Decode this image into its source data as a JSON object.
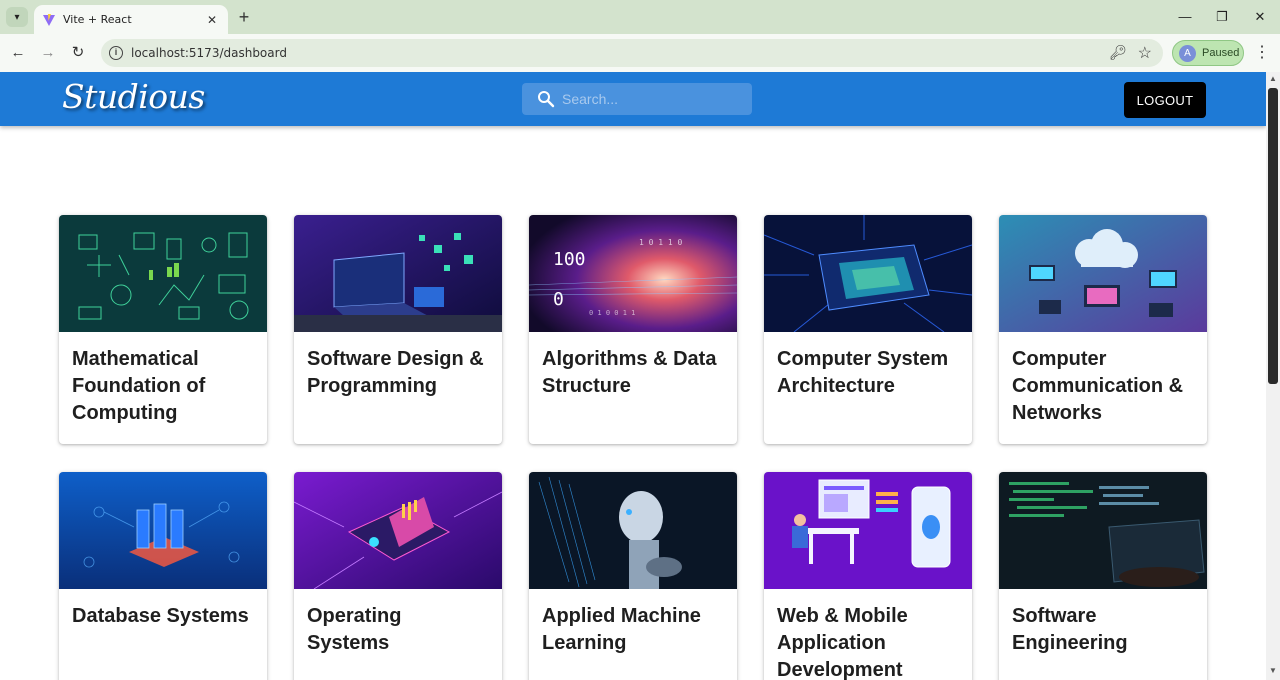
{
  "browser": {
    "tab_title": "Vite + React",
    "url": "localhost:5173/dashboard",
    "profile_initial": "A",
    "profile_state": "Paused",
    "icons": [
      "tab-search-icon",
      "vite-favicon-icon",
      "close-icon",
      "plus-icon",
      "minimize-icon",
      "restore-icon",
      "close-window-icon",
      "back-arrow-icon",
      "forward-arrow-icon",
      "reload-icon",
      "info-icon",
      "key-icon",
      "star-icon",
      "menu-dots-icon"
    ]
  },
  "header": {
    "brand": "Studious",
    "search_placeholder": "Search...",
    "logout_label": "LOGOUT",
    "colors": {
      "appbar": "#1e7ad6",
      "logout_bg": "#000000"
    }
  },
  "courses": [
    {
      "title": "Mathematical Foundation of Computing",
      "image": "math-icons-illustration"
    },
    {
      "title": "Software Design & Programming",
      "image": "laptop-code-illustration"
    },
    {
      "title": "Algorithms & Data Structure",
      "image": "binary-data-stream-illustration"
    },
    {
      "title": "Computer System Architecture",
      "image": "cpu-chip-illustration"
    },
    {
      "title": "Computer Communication & Networks",
      "image": "cloud-network-illustration"
    },
    {
      "title": "Database Systems",
      "image": "database-server-illustration"
    },
    {
      "title": "Operating Systems",
      "image": "isometric-laptop-illustration"
    },
    {
      "title": "Applied Machine Learning",
      "image": "robot-thinking-illustration"
    },
    {
      "title": "Web & Mobile Application Development",
      "image": "web-mobile-dev-illustration"
    },
    {
      "title": "Software Engineering",
      "image": "code-screen-illustration"
    }
  ]
}
